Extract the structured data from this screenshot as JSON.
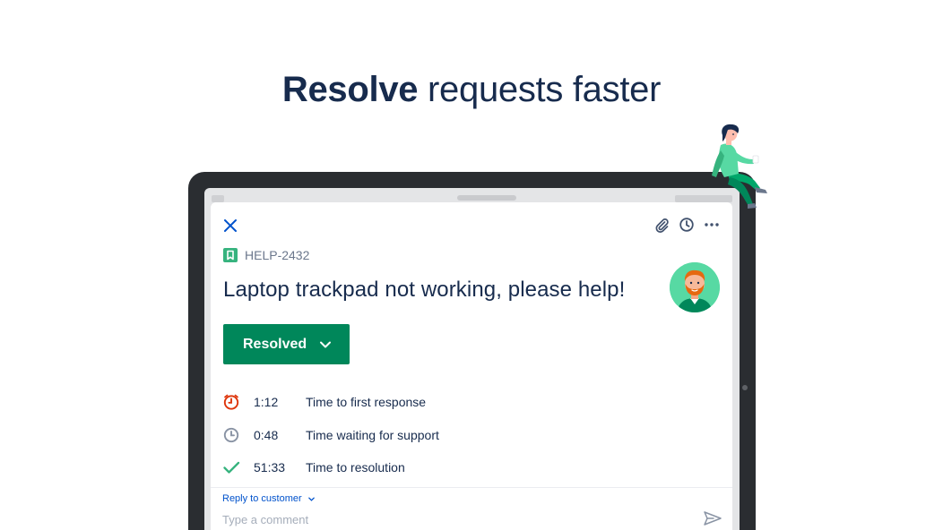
{
  "headline": {
    "bold": "Resolve",
    "rest": " requests faster"
  },
  "colors": {
    "navy": "#172b4d",
    "green": "#00875a",
    "accent_green": "#36b37e",
    "red": "#de350b",
    "blue": "#0052cc",
    "gray": "#6b778c"
  },
  "issue": {
    "type_icon": "bookmark-icon",
    "key": "HELP-2432",
    "title": "Laptop trackpad not working, please help!",
    "status": "Resolved"
  },
  "toolbar": {
    "icons": [
      "close-icon",
      "attachment-icon",
      "clock-icon",
      "more-icon"
    ]
  },
  "sla": [
    {
      "icon": "alarm-clock-icon",
      "time": "1:12",
      "label": "Time to first response",
      "color": "#de350b"
    },
    {
      "icon": "clock-icon",
      "time": "0:48",
      "label": "Time waiting for support",
      "color": "#8993a4"
    },
    {
      "icon": "checkmark-icon",
      "time": "51:33",
      "label": "Time to resolution",
      "color": "#36b37e"
    }
  ],
  "reply": {
    "mode_label": "Reply to customer",
    "placeholder": "Type a comment"
  }
}
